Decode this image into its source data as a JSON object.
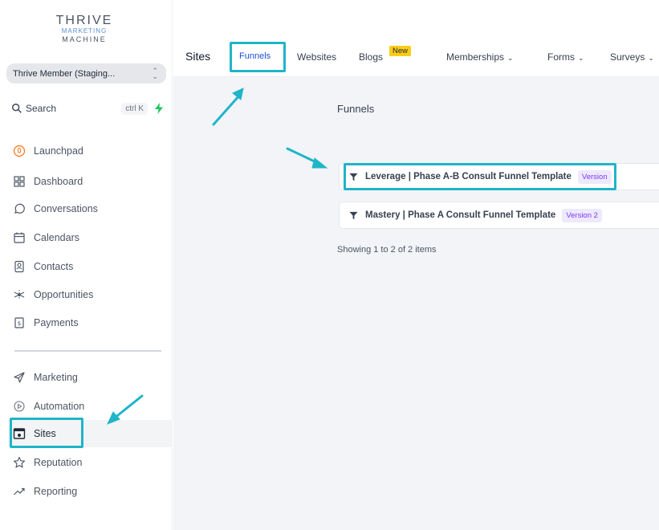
{
  "brand": {
    "line1": "THRIVE",
    "line2": "MARKETING",
    "line3": "MACHINE"
  },
  "account": {
    "name": "Thrive Member (Staging..."
  },
  "search": {
    "label": "Search",
    "shortcut": "ctrl K"
  },
  "sidebar": {
    "items": [
      {
        "label": "Launchpad",
        "icon": "rocket-icon"
      },
      {
        "label": "Dashboard",
        "icon": "grid-icon"
      },
      {
        "label": "Conversations",
        "icon": "chat-bubble-icon"
      },
      {
        "label": "Calendars",
        "icon": "calendar-icon"
      },
      {
        "label": "Contacts",
        "icon": "contact-book-icon"
      },
      {
        "label": "Opportunities",
        "icon": "network-icon"
      },
      {
        "label": "Payments",
        "icon": "dollar-doc-icon"
      },
      {
        "label": "Marketing",
        "icon": "send-icon"
      },
      {
        "label": "Automation",
        "icon": "automation-icon"
      },
      {
        "label": "Sites",
        "icon": "browser-window-icon",
        "active": true
      },
      {
        "label": "Reputation",
        "icon": "star-icon"
      },
      {
        "label": "Reporting",
        "icon": "trend-line-icon"
      }
    ]
  },
  "topnav": {
    "section": "Sites",
    "tabs": [
      {
        "label": "Funnels",
        "active": true
      },
      {
        "label": "Websites"
      },
      {
        "label": "Blogs",
        "badge": "New"
      },
      {
        "label": "Memberships",
        "dropdown": true
      },
      {
        "label": "Forms",
        "dropdown": true
      },
      {
        "label": "Surveys",
        "dropdown": true
      }
    ]
  },
  "funnels": {
    "title": "Funnels",
    "rows": [
      {
        "name": "Leverage | Phase A-B Consult Funnel Template",
        "version": "Version"
      },
      {
        "name": "Mastery | Phase A Consult Funnel Template",
        "version": "Version 2"
      }
    ],
    "pagination": "Showing 1 to 2 of 2 items"
  },
  "colors": {
    "highlight": "#1fb5c8",
    "accent": "#1d4ed8",
    "badge": "#facc15",
    "version_badge": "#ede9fe",
    "bolt": "#22c55e"
  }
}
